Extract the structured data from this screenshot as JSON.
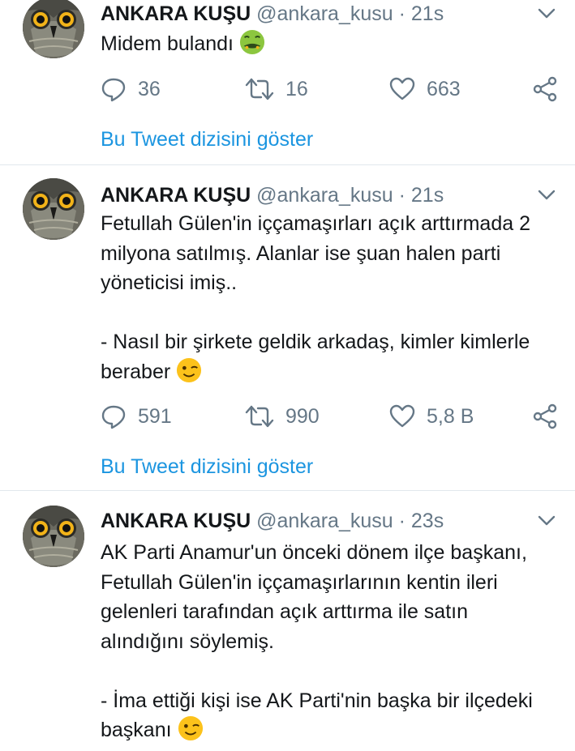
{
  "tweets": [
    {
      "author_name": "ANKARA KUŞU",
      "handle": "@ankara_kusu",
      "separator": "·",
      "time": "21s",
      "text": "Midem bulandı",
      "emoji": "nauseated-face",
      "replies": "36",
      "retweets": "16",
      "likes": "663",
      "show_thread": "Bu Tweet dizisini göster"
    },
    {
      "author_name": "ANKARA KUŞU",
      "handle": "@ankara_kusu",
      "separator": "·",
      "time": "21s",
      "text": "Fetullah Gülen'in iççamaşırları açık arttırmada 2 milyona satılmış. Alanlar ise şuan halen parti yöneticisi imiş..\n\n- Nasıl bir şirkete geldik arkadaş, kimler kimlerle beraber",
      "emoji": "winking-face",
      "replies": "591",
      "retweets": "990",
      "likes": "5,8 B",
      "show_thread": "Bu Tweet dizisini göster"
    },
    {
      "author_name": "ANKARA KUŞU",
      "handle": "@ankara_kusu",
      "separator": "·",
      "time": "23s",
      "text": "AK Parti Anamur'un önceki dönem ilçe başkanı, Fetullah Gülen'in iççamaşırlarının kentin ileri gelenleri tarafından açık arttırma ile satın alındığını söylemiş.\n\n- İma ettiği kişi ise AK Parti'nin başka bir ilçedeki başkanı",
      "emoji": "winking-face"
    }
  ],
  "colors": {
    "text": "#14171a",
    "secondary": "#657786",
    "link": "#1b95e0",
    "divider": "#e1e8ed"
  }
}
